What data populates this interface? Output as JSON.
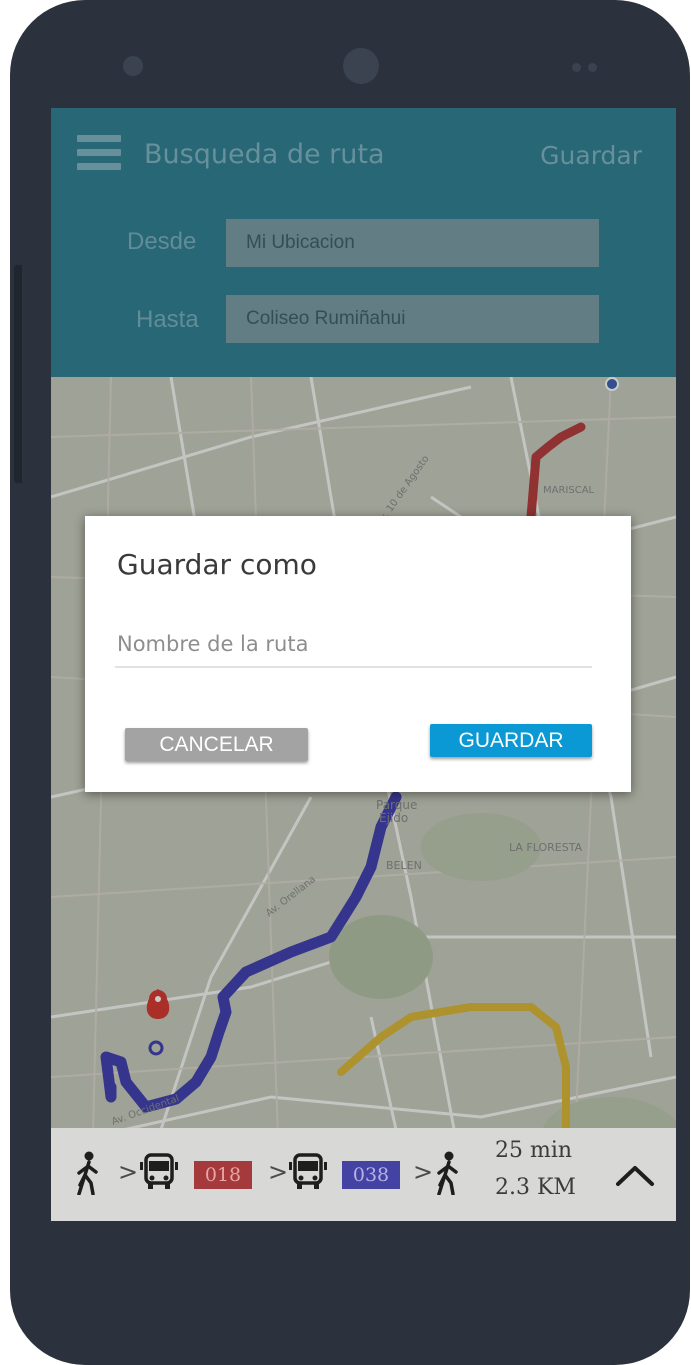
{
  "app": {
    "title": "Busqueda de ruta",
    "save_action": "Guardar"
  },
  "search": {
    "from_label": "Desde",
    "from_value": "Mi Ubicacion",
    "to_label": "Hasta",
    "to_value": "Coliseo Rumiñahui"
  },
  "map": {
    "labels": [
      "Parque",
      "Ejido",
      "BELEN",
      "LA FLORESTA",
      "MARISCAL",
      "Av. Orellana",
      "Av. 10 de Agosto",
      "Av. Occidental"
    ],
    "route_colors": {
      "walk_start": "#b43c3c",
      "bus_018": "#b43c3c",
      "bus_038": "#3f3fb0",
      "walk_end": "#d9b636"
    }
  },
  "dialog": {
    "title": "Guardar como",
    "name_placeholder": "Nombre de la ruta",
    "cancel_label": "CANCELAR",
    "save_label": "GUARDAR"
  },
  "itinerary": {
    "steps": [
      {
        "type": "walk",
        "icon": "walk-icon"
      },
      {
        "type": "bus",
        "icon": "bus-icon",
        "line": "018",
        "color": "#a53a3c"
      },
      {
        "type": "bus",
        "icon": "bus-icon",
        "line": "038",
        "color": "#4442a2"
      },
      {
        "type": "walk",
        "icon": "walk-icon"
      }
    ],
    "separator": ">",
    "duration": "25 min",
    "distance": "2.3 KM"
  },
  "icons": {
    "menu": "hamburger-menu-icon",
    "expand": "chevron-up-icon",
    "pin": "location-pin-icon"
  },
  "colors": {
    "app_bar": "#2e7f93",
    "save_button": "#0a99d4",
    "cancel_button": "#a3a3a3",
    "phone_body": "#2b323d"
  }
}
